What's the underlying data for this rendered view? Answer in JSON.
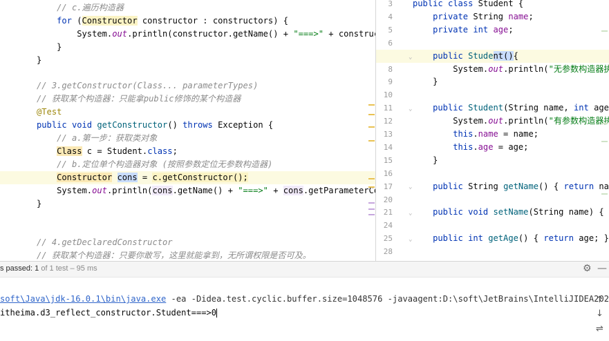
{
  "left_editor": {
    "lines": [
      {
        "segs": [
          [
            "    ",
            ""
          ],
          [
            "// c.遍历构造器",
            "cmt"
          ]
        ]
      },
      {
        "segs": [
          [
            "    ",
            ""
          ],
          [
            "for",
            "kw"
          ],
          [
            " (",
            ""
          ],
          [
            "Constructor",
            "hl-yellow"
          ],
          [
            " constructor : constructors) {",
            ""
          ]
        ]
      },
      {
        "segs": [
          [
            "        System.",
            ""
          ],
          [
            "out",
            "static"
          ],
          [
            ".println(constructor.getName() + ",
            ""
          ],
          [
            "\"===>\"",
            "str"
          ],
          [
            " + constructor",
            ""
          ]
        ]
      },
      {
        "segs": [
          [
            "    }",
            ""
          ]
        ]
      },
      {
        "segs": [
          [
            "}",
            ""
          ]
        ]
      },
      {
        "segs": [
          [
            "",
            ""
          ]
        ]
      },
      {
        "segs": [
          [
            "// 3.getConstructor(Class... parameterTypes)",
            "cmt"
          ]
        ]
      },
      {
        "segs": [
          [
            "// 获取某个构造器：只能拿public修饰的某个构造器",
            "cmt"
          ]
        ]
      },
      {
        "segs": [
          [
            "@Test",
            "ann"
          ]
        ]
      },
      {
        "segs": [
          [
            "public void ",
            "kw"
          ],
          [
            "getConstructor",
            "fn"
          ],
          [
            "() ",
            ""
          ],
          [
            "throws",
            "kw"
          ],
          [
            " Exception {",
            ""
          ]
        ]
      },
      {
        "segs": [
          [
            "    ",
            ""
          ],
          [
            "// a.第一步：获取类对象",
            "cmt"
          ]
        ]
      },
      {
        "segs": [
          [
            "    ",
            ""
          ],
          [
            "Class",
            "hl-type"
          ],
          [
            " c = Student.",
            ""
          ],
          [
            "class",
            "kw"
          ],
          [
            ";",
            ""
          ]
        ]
      },
      {
        "segs": [
          [
            "    ",
            ""
          ],
          [
            "// b.定位单个构造器对象 (按照参数定位无参数构造器)",
            "cmt"
          ]
        ]
      },
      {
        "segs": [
          [
            "    ",
            ""
          ],
          [
            "Constructor",
            "hl-type"
          ],
          [
            " ",
            ""
          ],
          [
            "cons",
            "hl-blue"
          ],
          [
            " = ",
            ""
          ],
          [
            "c.getConstructor();",
            "hl-yellow"
          ]
        ],
        "bg": "hl-line"
      },
      {
        "segs": [
          [
            "    System.",
            ""
          ],
          [
            "out",
            "static"
          ],
          [
            ".println(",
            ""
          ],
          [
            "cons",
            "hl-purple"
          ],
          [
            ".getName() + ",
            ""
          ],
          [
            "\"===>\"",
            "str"
          ],
          [
            " + ",
            ""
          ],
          [
            "cons",
            "hl-purple"
          ],
          [
            ".getParameterCount",
            ""
          ]
        ]
      },
      {
        "segs": [
          [
            "}",
            ""
          ]
        ]
      },
      {
        "segs": [
          [
            "",
            ""
          ]
        ]
      },
      {
        "segs": [
          [
            "",
            ""
          ]
        ]
      },
      {
        "segs": [
          [
            "// 4.getDeclaredConstructor",
            "cmt"
          ]
        ]
      },
      {
        "segs": [
          [
            "// 获取某个构造器：只要你敢写，这里就能拿到，无所谓权限是否可及。",
            "cmt"
          ]
        ]
      }
    ]
  },
  "right_editor": {
    "lines": [
      {
        "num": "3",
        "segs": [
          [
            "public class ",
            "kw"
          ],
          [
            "Student {",
            ""
          ]
        ]
      },
      {
        "num": "4",
        "segs": [
          [
            "    ",
            ""
          ],
          [
            "private ",
            "kw"
          ],
          [
            "String ",
            ""
          ],
          [
            "name",
            "fld"
          ],
          [
            ";",
            ""
          ]
        ]
      },
      {
        "num": "5",
        "segs": [
          [
            "    ",
            ""
          ],
          [
            "private int ",
            "kw"
          ],
          [
            "age",
            "fld"
          ],
          [
            ";",
            ""
          ]
        ]
      },
      {
        "num": "6",
        "segs": [
          [
            "",
            ""
          ]
        ]
      },
      {
        "num": "7",
        "segs": [
          [
            "    ",
            ""
          ],
          [
            "public ",
            "kw"
          ],
          [
            "Stude",
            "fn"
          ],
          [
            "nt",
            "hl-blue"
          ],
          [
            "()",
            "hl-blue"
          ],
          [
            "{",
            ""
          ]
        ],
        "bg": "hl-line"
      },
      {
        "num": "8",
        "segs": [
          [
            "        System.",
            ""
          ],
          [
            "out",
            "static"
          ],
          [
            ".println(",
            ""
          ],
          [
            "\"无参数构造器执行",
            "str"
          ]
        ]
      },
      {
        "num": "9",
        "segs": [
          [
            "    }",
            ""
          ]
        ]
      },
      {
        "num": "10",
        "segs": [
          [
            "",
            ""
          ]
        ]
      },
      {
        "num": "11",
        "segs": [
          [
            "    ",
            ""
          ],
          [
            "public ",
            "kw"
          ],
          [
            "Student",
            "fn"
          ],
          [
            "(String name, ",
            ""
          ],
          [
            "int ",
            "kw"
          ],
          [
            "age)",
            ""
          ]
        ]
      },
      {
        "num": "12",
        "segs": [
          [
            "        System.",
            ""
          ],
          [
            "out",
            "static"
          ],
          [
            ".println(",
            ""
          ],
          [
            "\"有参数构造器执行",
            "str"
          ]
        ]
      },
      {
        "num": "13",
        "segs": [
          [
            "        ",
            ""
          ],
          [
            "this",
            "kw"
          ],
          [
            ".",
            ""
          ],
          [
            "name",
            "fld"
          ],
          [
            " = name;",
            ""
          ]
        ]
      },
      {
        "num": "14",
        "segs": [
          [
            "        ",
            ""
          ],
          [
            "this",
            "kw"
          ],
          [
            ".",
            ""
          ],
          [
            "age",
            "fld"
          ],
          [
            " = age;",
            ""
          ]
        ]
      },
      {
        "num": "15",
        "segs": [
          [
            "    }",
            ""
          ]
        ]
      },
      {
        "num": "16",
        "segs": [
          [
            "",
            ""
          ]
        ]
      },
      {
        "num": "17",
        "segs": [
          [
            "    ",
            ""
          ],
          [
            "public ",
            "kw"
          ],
          [
            "String ",
            ""
          ],
          [
            "getName",
            "fn"
          ],
          [
            "() { ",
            ""
          ],
          [
            "return ",
            "kw"
          ],
          [
            "name",
            ""
          ]
        ]
      },
      {
        "num": "20",
        "segs": [
          [
            "",
            ""
          ]
        ]
      },
      {
        "num": "21",
        "segs": [
          [
            "    ",
            ""
          ],
          [
            "public void ",
            "kw"
          ],
          [
            "setName",
            "fn"
          ],
          [
            "(String name) { ",
            ""
          ],
          [
            "th",
            "kw"
          ]
        ]
      },
      {
        "num": "24",
        "segs": [
          [
            "",
            ""
          ]
        ]
      },
      {
        "num": "25",
        "segs": [
          [
            "    ",
            ""
          ],
          [
            "public int ",
            "kw"
          ],
          [
            "getAge",
            "fn"
          ],
          [
            "() { ",
            ""
          ],
          [
            "return ",
            "kw"
          ],
          [
            "age",
            ""
          ],
          [
            "; }",
            ""
          ]
        ]
      },
      {
        "num": "28",
        "segs": [
          [
            "",
            ""
          ]
        ]
      }
    ]
  },
  "run_panel": {
    "status_main": "s passed: 1",
    "status_sub": " of 1 test – 95 ms",
    "command_path": "soft\\Java\\jdk-16.0.1\\bin\\java.exe",
    "command_args": " -ea -Didea.test.cyclic.buffer.size=1048576 -javaagent:D:\\soft\\JetBrains\\IntelliJIDEA2021.1.",
    "output_line": "itheima.d3_reflect_constructor.Student===>0"
  },
  "icons": {
    "settings": "gear-icon",
    "minimize": "minus-icon",
    "up": "arrow-up-icon",
    "down": "arrow-down-icon",
    "wrap": "soft-wrap-icon"
  }
}
